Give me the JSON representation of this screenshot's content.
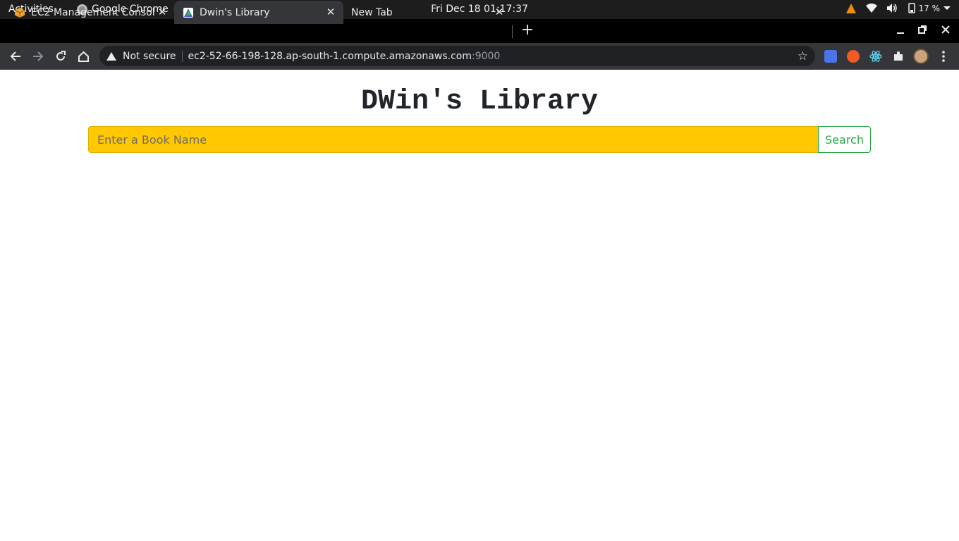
{
  "system_bar": {
    "activities": "Activities",
    "app_name": "Google Chrome",
    "clock": "Fri Dec 18  01:17:37",
    "battery": "17 %"
  },
  "tabs": [
    {
      "title": "EC2 Management Console",
      "active": false
    },
    {
      "title": "Dwin's Library",
      "active": true
    },
    {
      "title": "New Tab",
      "active": false
    }
  ],
  "omnibox": {
    "security_label": "Not secure",
    "url_host": "ec2-52-66-198-128.ap-south-1.compute.amazonaws.com",
    "url_port": ":9000"
  },
  "page": {
    "title": "DWin's Library",
    "search_placeholder": "Enter a Book Name",
    "search_button": "Search"
  },
  "colors": {
    "search_input_bg": "#ffc800",
    "search_button_accent": "#28a745"
  }
}
